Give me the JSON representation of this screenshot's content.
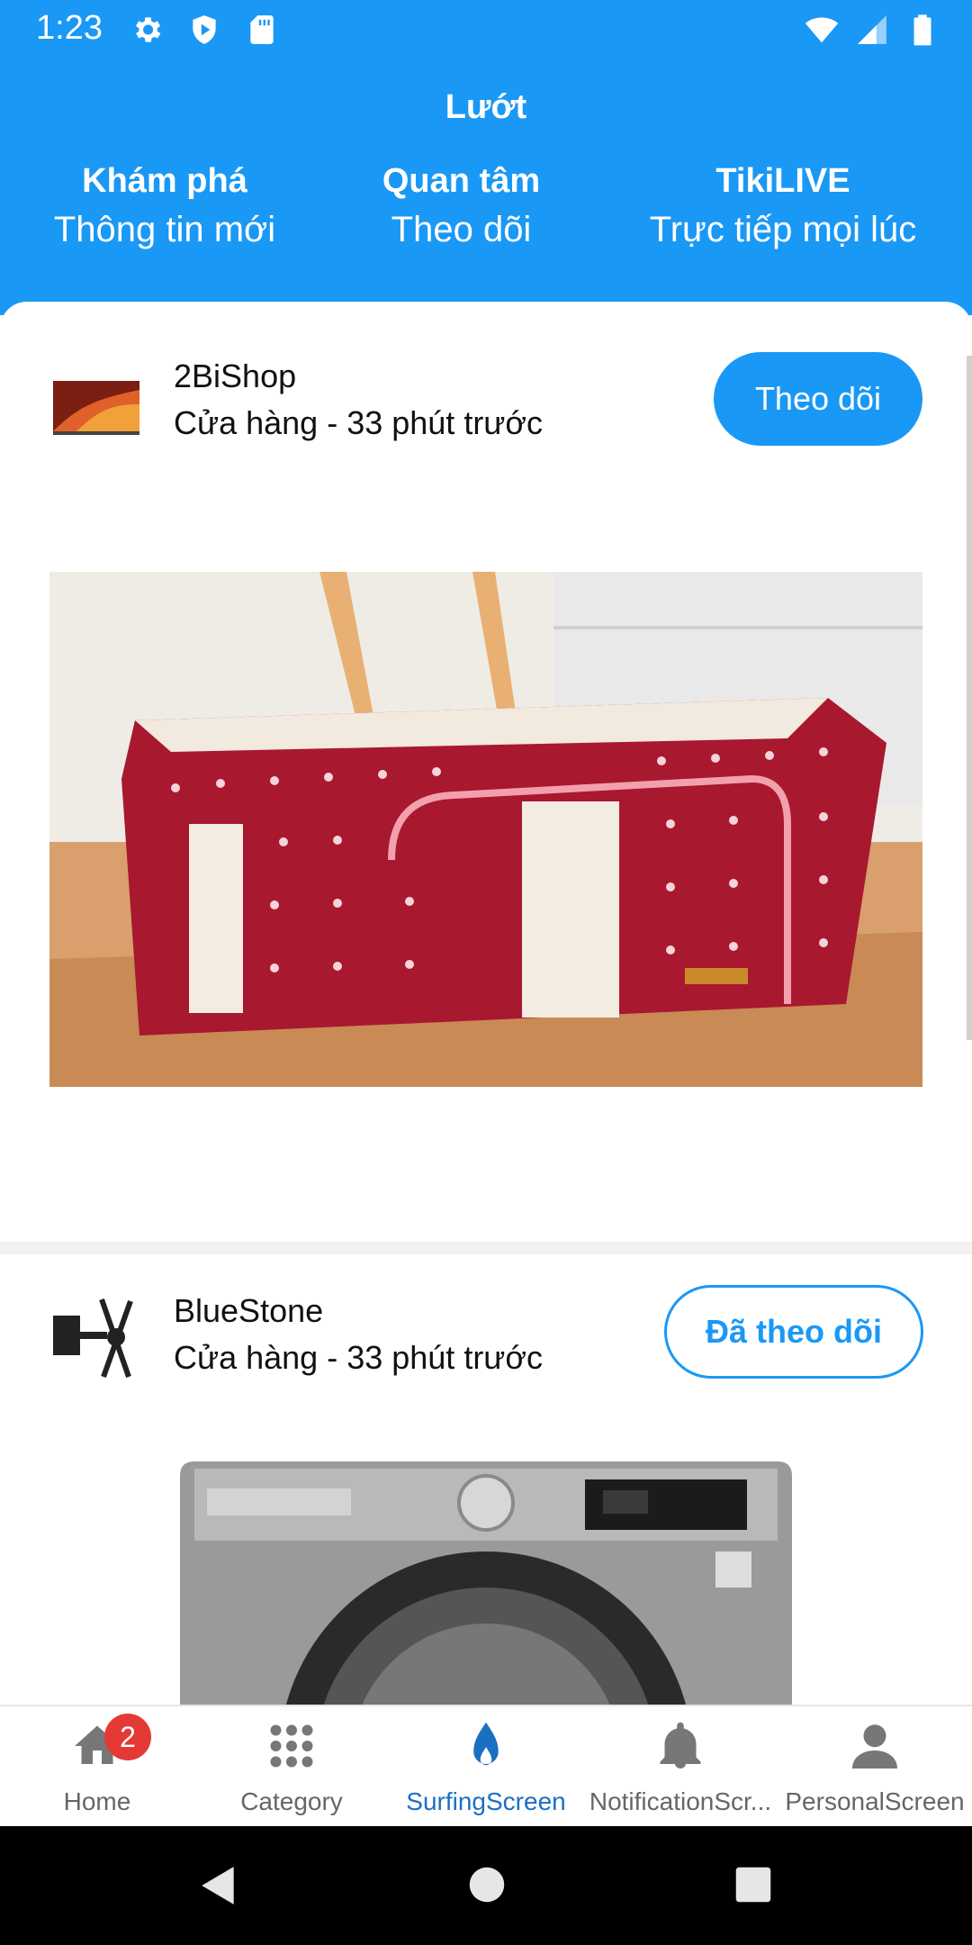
{
  "status_bar": {
    "time": "1:23",
    "icons": [
      "gear-icon",
      "shield-icon",
      "sd-card-icon",
      "wifi-icon",
      "signal-icon",
      "battery-icon"
    ]
  },
  "header": {
    "title": "Lướt",
    "tabs": [
      {
        "title": "Khám phá",
        "subtitle": "Thông tin mới"
      },
      {
        "title": "Quan tâm",
        "subtitle": "Theo dõi"
      },
      {
        "title": "TikiLIVE",
        "subtitle": "Trực tiếp mọi lúc"
      }
    ]
  },
  "feed": {
    "posts": [
      {
        "shop_name": "2BiShop",
        "meta": "Cửa hàng - 33 phút trước",
        "follow_label": "Theo dõi",
        "followed": false,
        "image": "red-polka-dot-storage-box"
      },
      {
        "shop_name": "BlueStone",
        "meta": "Cửa hàng - 33 phút trước",
        "follow_label": "Đã theo dõi",
        "followed": true,
        "image": "lg-washing-machine"
      }
    ]
  },
  "bottom_nav": {
    "items": [
      {
        "label": "Home",
        "icon": "home-icon",
        "badge": "2",
        "active": false
      },
      {
        "label": "Category",
        "icon": "grid-icon",
        "active": false
      },
      {
        "label": "SurfingScreen",
        "icon": "flame-icon",
        "active": true
      },
      {
        "label": "NotificationScr...",
        "icon": "bell-icon",
        "active": false
      },
      {
        "label": "PersonalScreen",
        "icon": "person-icon",
        "active": false
      }
    ]
  },
  "colors": {
    "primary": "#1a98f5",
    "active_nav": "#1b6fc2",
    "badge": "#e53935"
  }
}
